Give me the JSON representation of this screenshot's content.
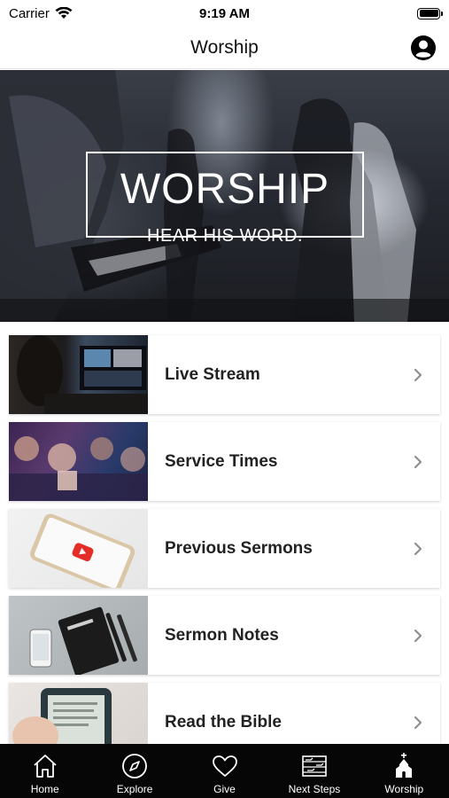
{
  "status_bar": {
    "carrier": "Carrier",
    "time": "9:19 AM"
  },
  "nav": {
    "title": "Worship",
    "profile_icon": "user-circle-icon"
  },
  "hero": {
    "title": "WORSHIP",
    "subtitle": "HEAR HIS WORD."
  },
  "list": {
    "items": [
      {
        "label": "Live Stream",
        "icon": "chevron-right-icon"
      },
      {
        "label": "Service Times",
        "icon": "chevron-right-icon"
      },
      {
        "label": "Previous Sermons",
        "icon": "chevron-right-icon"
      },
      {
        "label": "Sermon Notes",
        "icon": "chevron-right-icon"
      },
      {
        "label": "Read the Bible",
        "icon": "chevron-right-icon"
      }
    ]
  },
  "tab_bar": {
    "tabs": [
      {
        "label": "Home",
        "icon": "home-icon"
      },
      {
        "label": "Explore",
        "icon": "compass-icon"
      },
      {
        "label": "Give",
        "icon": "heart-icon"
      },
      {
        "label": "Next Steps",
        "icon": "steps-icon"
      },
      {
        "label": "Worship",
        "icon": "chapel-icon",
        "active": true
      }
    ]
  },
  "colors": {
    "tab_bar_bg": "#060606",
    "text_primary": "#222222",
    "chevron": "#8e8e93"
  }
}
